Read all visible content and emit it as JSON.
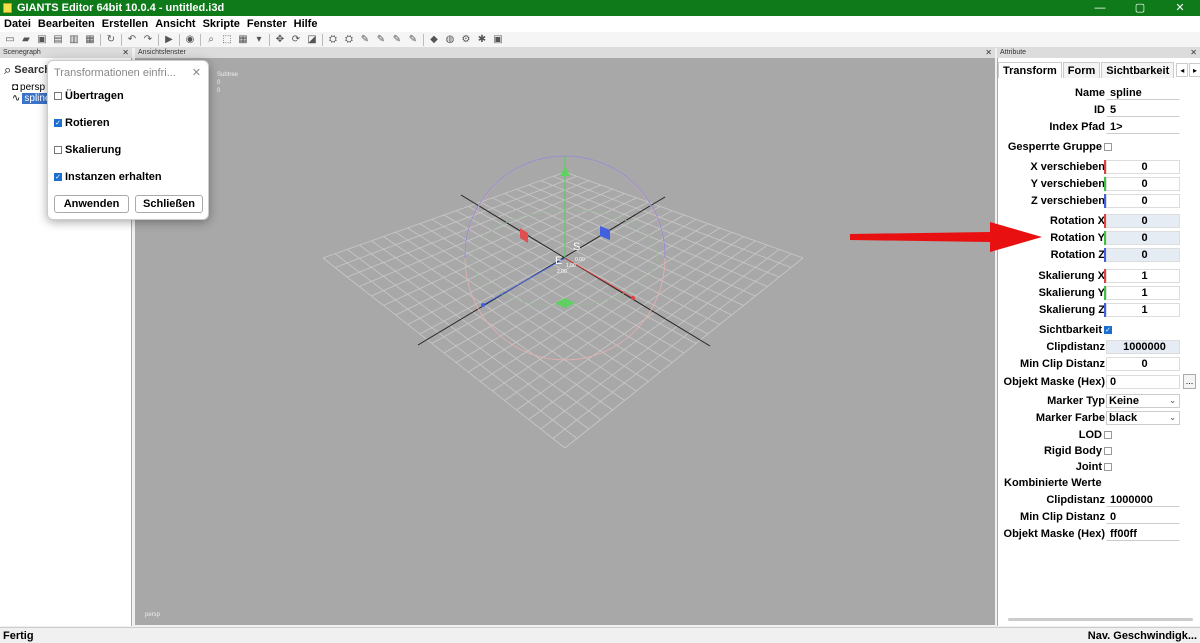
{
  "window": {
    "title": "GIANTS Editor 64bit 10.0.4 - untitled.i3d",
    "minimize": "—",
    "maximize": "▢",
    "close": "✕"
  },
  "menu": [
    "Datei",
    "Bearbeiten",
    "Erstellen",
    "Ansicht",
    "Skripte",
    "Fenster",
    "Hilfe"
  ],
  "panels": {
    "scenegraph": "Scenegraph",
    "viewport": "Ansichtsfenster",
    "attributes": "Attribute"
  },
  "scenegraph": {
    "search_placeholder": "Search",
    "items": [
      {
        "label": "persp",
        "icon": "camera-icon"
      },
      {
        "label": "spline",
        "icon": "spline-icon",
        "selected": true
      }
    ]
  },
  "viewport": {
    "overlay_top": [
      "Subtree",
      "0",
      "0"
    ],
    "gizmo_label_s": "S",
    "gizmo_label_e": "E",
    "gizmo_val_1": "0.00",
    "gizmo_val_2": "1.00",
    "gizmo_val_3": "2.00",
    "camera_label": "persp"
  },
  "dialog": {
    "title": "Transformationen einfri...",
    "close": "✕",
    "options": [
      {
        "label": "Übertragen",
        "checked": false
      },
      {
        "label": "Rotieren",
        "checked": true
      },
      {
        "label": "Skalierung",
        "checked": false
      },
      {
        "label": "Instanzen erhalten",
        "checked": true
      }
    ],
    "apply": "Anwenden",
    "close_button": "Schließen"
  },
  "attributes": {
    "tabs": [
      "Transform",
      "Form",
      "Sichtbarkeit"
    ],
    "arrow_left": "◂",
    "arrow_right": "▸",
    "name_label": "Name",
    "name_value": "spline",
    "id_label": "ID",
    "id_value": "5",
    "index_label": "Index Pfad",
    "index_value": "1>",
    "locked_label": "Gesperrte Gruppe",
    "x_trans_label": "X verschieben",
    "x_trans": "0",
    "y_trans_label": "Y verschieben",
    "y_trans": "0",
    "z_trans_label": "Z verschieben",
    "z_trans": "0",
    "x_rot_label": "Rotation X",
    "x_rot": "0",
    "y_rot_label": "Rotation Y",
    "y_rot": "0",
    "z_rot_label": "Rotation Z",
    "z_rot": "0",
    "x_scale_label": "Skalierung X",
    "x_scale": "1",
    "y_scale_label": "Skalierung Y",
    "y_scale": "1",
    "z_scale_label": "Skalierung Z",
    "z_scale": "1",
    "visibility_label": "Sichtbarkeit",
    "clip_label": "Clipdistanz",
    "clip_value": "1000000",
    "min_clip_label": "Min Clip Distanz",
    "min_clip_value": "0",
    "mask_label": "Objekt Maske (Hex)",
    "mask_value": "0",
    "mask_btn": "...",
    "marker_type_label": "Marker Typ",
    "marker_type": "Keine",
    "marker_color_label": "Marker Farbe",
    "marker_color": "black",
    "lod_label": "LOD",
    "rigid_label": "Rigid Body",
    "joint_label": "Joint",
    "combined_label": "Kombinierte Werte",
    "c_clip_label": "Clipdistanz",
    "c_clip_value": "1000000",
    "c_min_clip_label": "Min Clip Distanz",
    "c_min_clip_value": "0",
    "c_mask_label": "Objekt Maske (Hex)",
    "c_mask_value": "ff00ff"
  },
  "status": {
    "left": "Fertig",
    "right": "Nav. Geschwindigk..."
  },
  "colors": {
    "titlebar": "#0f7a1a",
    "selection": "#3a73c8",
    "check": "#1b6fd1",
    "arrow": "#e81010",
    "axis_x": "#e04040",
    "axis_y": "#40c040",
    "axis_z": "#4060e0"
  }
}
